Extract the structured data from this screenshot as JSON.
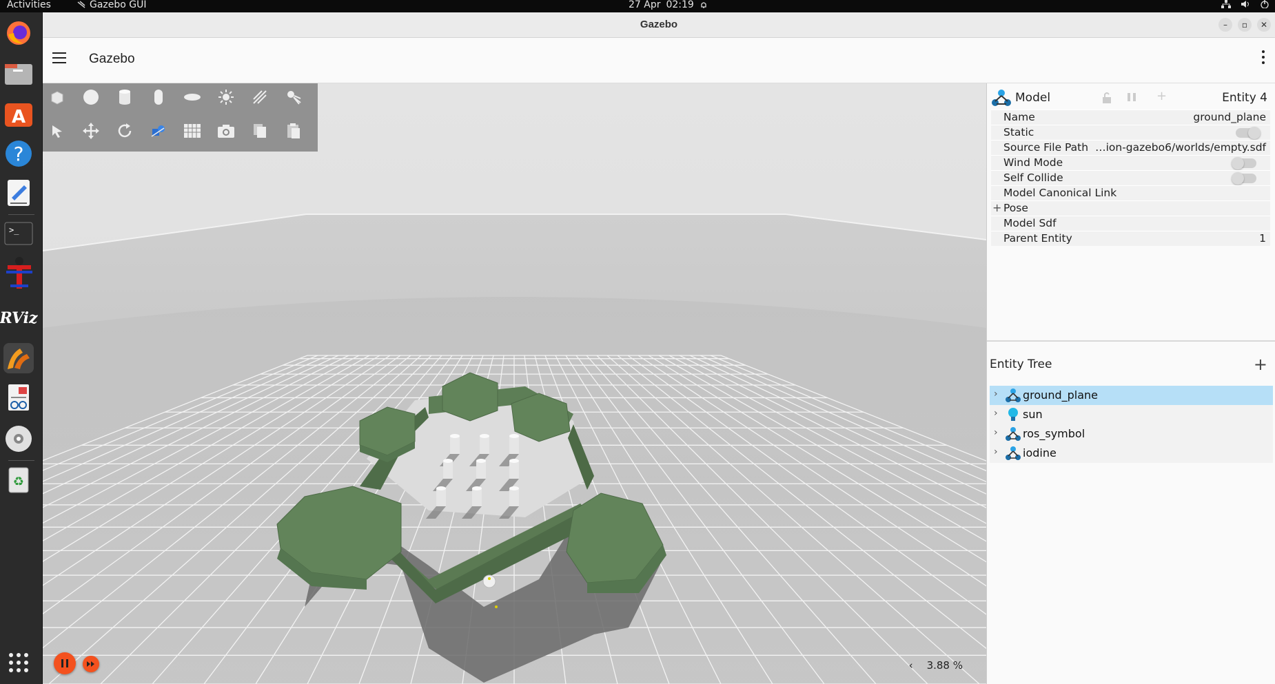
{
  "topbar": {
    "activities": "Activities",
    "app_name": "Gazebo GUI",
    "date": "27 Apr",
    "time": "02:19"
  },
  "dock": {
    "items": [
      "firefox-icon",
      "files-icon",
      "app-store-icon",
      "help-icon",
      "text-editor-icon",
      "terminal-icon",
      "tutorial-icon",
      "rviz-icon",
      "gazebo-icon",
      "document-viewer-icon",
      "disc-icon",
      "trash-icon",
      "app-grid-icon"
    ],
    "rviz_label": "RViz"
  },
  "window": {
    "title": "Gazebo",
    "app_title": "Gazebo"
  },
  "toolbar": {
    "row1": [
      "box-icon",
      "sphere-icon",
      "cylinder-icon",
      "capsule-icon",
      "ellipsoid-icon",
      "sun-light-icon",
      "directional-light-icon",
      "spot-light-icon"
    ],
    "row2": [
      "select-icon",
      "translate-icon",
      "rotate-icon",
      "transform-icon",
      "grid-snap-icon",
      "camera-icon",
      "copy-icon",
      "paste-icon"
    ]
  },
  "playback": {
    "rtf_value": "3.88 %",
    "collapse": "‹"
  },
  "inspector": {
    "type": "Model",
    "entity": "Entity 4",
    "rows": [
      {
        "key": "Name",
        "value": "ground_plane"
      },
      {
        "key": "Static",
        "value": ""
      },
      {
        "key": "Source File Path",
        "value": "…ion-gazebo6/worlds/empty.sdf"
      },
      {
        "key": "Wind Mode",
        "value": ""
      },
      {
        "key": "Self Collide",
        "value": ""
      },
      {
        "key": "Model Canonical Link",
        "value": ""
      },
      {
        "key": "Pose",
        "value": ""
      },
      {
        "key": "Model Sdf",
        "value": ""
      },
      {
        "key": "Parent Entity",
        "value": "1"
      }
    ],
    "pose_expand": "+"
  },
  "entity_tree": {
    "title": "Entity Tree",
    "add": "+",
    "items": [
      {
        "label": "ground_plane",
        "icon": "model-icon",
        "selected": true
      },
      {
        "label": "sun",
        "icon": "light-bulb-icon",
        "selected": false
      },
      {
        "label": "ros_symbol",
        "icon": "model-icon",
        "selected": false
      },
      {
        "label": "iodine",
        "icon": "model-icon",
        "selected": false
      }
    ]
  },
  "colors": {
    "accent": "#f4511e",
    "selection": "#b6dff7",
    "model_green": "#5e7f56"
  }
}
